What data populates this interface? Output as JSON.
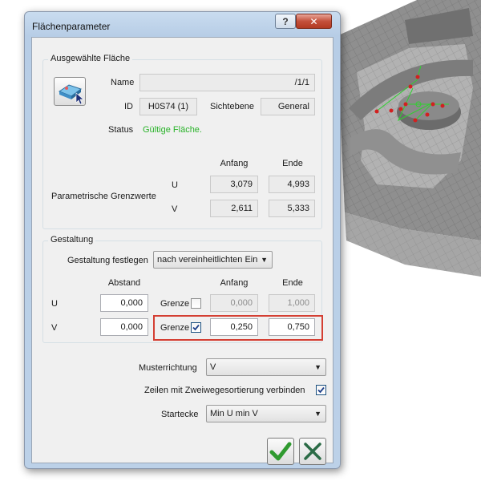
{
  "window": {
    "title": "Flächenparameter",
    "help_glyph": "?",
    "close_glyph": "✕"
  },
  "selected_surface": {
    "group_label": "Ausgewählte Fläche",
    "icon": "surface-select-icon",
    "name_label": "Name",
    "name_value": "/1/1",
    "id_label": "ID",
    "id_value": "H0S74 (1)",
    "visibility_label": "Sichtebene",
    "visibility_value": "General",
    "status_label": "Status",
    "status_value": "Gültige Fläche.",
    "status_color": "#2ab32a",
    "limits_label": "Parametrische Grenzwerte",
    "start_header": "Anfang",
    "end_header": "Ende",
    "u_label": "U",
    "u_start": "3,079",
    "u_end": "4,993",
    "v_label": "V",
    "v_start": "2,611",
    "v_end": "5,333"
  },
  "design": {
    "group_label": "Gestaltung",
    "set_label": "Gestaltung festlegen",
    "set_value": "nach vereinheitlichten Einh",
    "distance_header": "Abstand",
    "start_header": "Anfang",
    "end_header": "Ende",
    "u_label": "U",
    "u_distance": "0,000",
    "u_limit_label": "Grenze",
    "u_limit_checked": false,
    "u_start": "0,000",
    "u_end": "1,000",
    "v_label": "V",
    "v_distance": "0,000",
    "v_limit_label": "Grenze",
    "v_limit_checked": true,
    "v_start": "0,250",
    "v_end": "0,750",
    "highlight_color": "#d43f33"
  },
  "pattern": {
    "direction_label": "Musterrichtung",
    "direction_value": "V",
    "connect_label": "Zeilen mit Zweiwegesortierung verbinden",
    "connect_checked": true,
    "start_corner_label": "Startecke",
    "start_corner_value": "Min U min V"
  },
  "buttons": {
    "ok_icon": "checkmark-icon",
    "cancel_icon": "cross-icon",
    "ok_color": "#2f9a2f",
    "cancel_color": "#2b6b46"
  }
}
